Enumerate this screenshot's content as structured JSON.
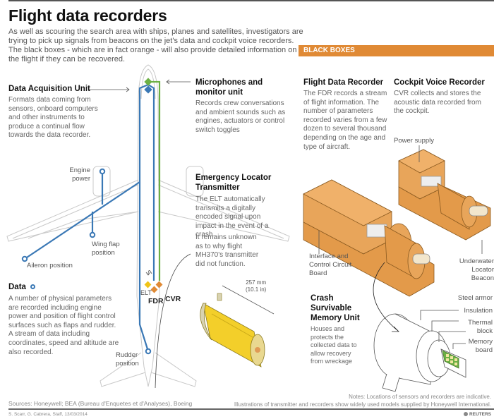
{
  "header": {
    "title": "Flight data recorders",
    "intro": "As well as scouring the search area with ships, planes and satellites, investigators are trying to pick up signals from beacons on the jet's data and cockpit voice recorders. The black boxes - which are in fact orange - will also provide detailed information on the flight if they can be recovered."
  },
  "left": {
    "dau": {
      "title": "Data Acquisition Unit",
      "text": "Formats data coming from sensors, onboard computers and other instruments to produce a continual flow towards the data recorder."
    },
    "microphones": {
      "title": "Microphones and monitor unit",
      "text": "Records crew conversations and ambient sounds such as engines, actuators or control switch toggles"
    },
    "elt": {
      "title": "Emergency Locator Transmitter",
      "text1": "The ELT automatically transmits a digitally encoded signal upon impact in the event of a crash.",
      "text2": "It remains unknown as to why flight MH370's transmitter did not function.",
      "dimension_mm": "257 mm",
      "dimension_in": "(10.1 in)"
    },
    "data": {
      "title": "Data",
      "text": "A number of physical parameters are recorded including engine power and position of flight control surfaces such as flaps and rudder. A stream of data including coordinates, speed and altitude are also recorded."
    },
    "sensor_labels": {
      "engine": "Engine power",
      "wing_flap": "Wing flap position",
      "aileron": "Aileron position",
      "rudder": "Rudder position"
    },
    "recorder_labels": {
      "elt": "ELT",
      "fdr": "FDR",
      "cvr": "CVR"
    }
  },
  "right": {
    "banner": "BLACK BOXES",
    "fdr": {
      "title": "Flight Data Recorder",
      "text": "The FDR records a stream of flight information. The number of parameters recorded varies from a few dozen to several thousand depending on the age and type of aircraft."
    },
    "cvr": {
      "title": "Cockpit Voice Recorder",
      "text": "CVR collects and stores the acoustic data recorded from the cockpit."
    },
    "labels": {
      "power_supply": "Power supply",
      "interface": "Interface and Control Circuit Board",
      "beacon": "Underwater Locator Beacon"
    },
    "csmu": {
      "title": "Crash Survivable Memory Unit",
      "text": "Houses and protects the collected data to allow recovery from wreckage",
      "parts": [
        "Steel armor",
        "Insulation",
        "Thermal block",
        "Memory board"
      ]
    }
  },
  "colors": {
    "data_line": "#3a78b5",
    "audio_line": "#6cb044",
    "orange": "#e08a35",
    "elt_yellow": "#f0c419",
    "recorder_box": "#e39a4a"
  },
  "footer": {
    "sources": "Sources: Honeywell; BEA (Bureau d'Enquetes et d'Analyses), Boeing",
    "byline": "S. Scarr, G. Cabrera, Staff, 13/03/2014",
    "notes1": "Notes: Locations of sensors and recorders are indicative.",
    "notes2": "Illustrations of transmitter and recorders show widely used models supplied by Honeywell International.",
    "brand": "REUTERS"
  }
}
